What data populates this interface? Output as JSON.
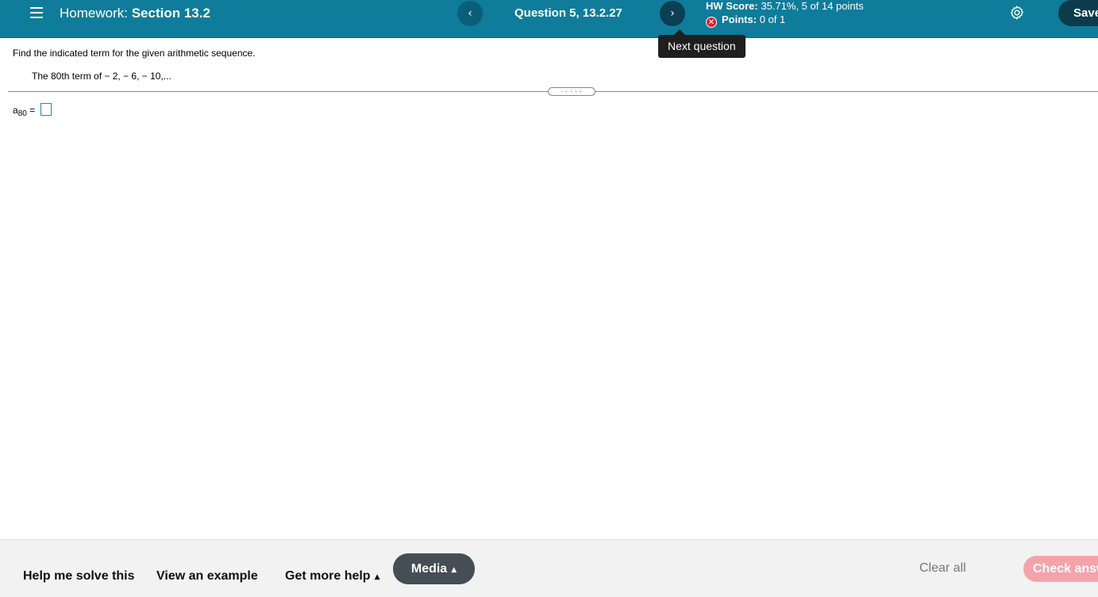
{
  "header": {
    "homework_prefix": "Homework:",
    "section": "Section 13.2",
    "prev_icon": "‹",
    "next_icon": "›",
    "question_label": "Question 5, 13.2.27",
    "score_label": "HW Score:",
    "score_value": "35.71%, 5 of 14 points",
    "points_label": "Points:",
    "points_value": "0 of 1",
    "save_label": "Save",
    "icons": {
      "menu": "hamburger-icon",
      "settings": "gear-icon",
      "status": "x-circle-icon"
    },
    "colors": {
      "bar": "#0e7c9a",
      "status_wrong": "#d9232d"
    }
  },
  "tooltip": {
    "text": "Next question"
  },
  "question": {
    "instruction": "Find the indicated term for the given arithmetic sequence.",
    "prompt_prefix": "The 80th term of",
    "sequence": " − 2, − 6, − 10,...",
    "answer_var": "a",
    "answer_sub": "80",
    "answer_eq": "=",
    "answer_value": "",
    "divider_handle": "....."
  },
  "footer": {
    "help_solve": "Help me solve this",
    "view_example": "View an example",
    "more_help": "Get more help",
    "media": "Media",
    "clear_all": "Clear all",
    "check_answer": "Check answer",
    "caret": "▲",
    "colors": {
      "media_bg": "#454d55",
      "check_bg": "#f5a3ab"
    }
  }
}
